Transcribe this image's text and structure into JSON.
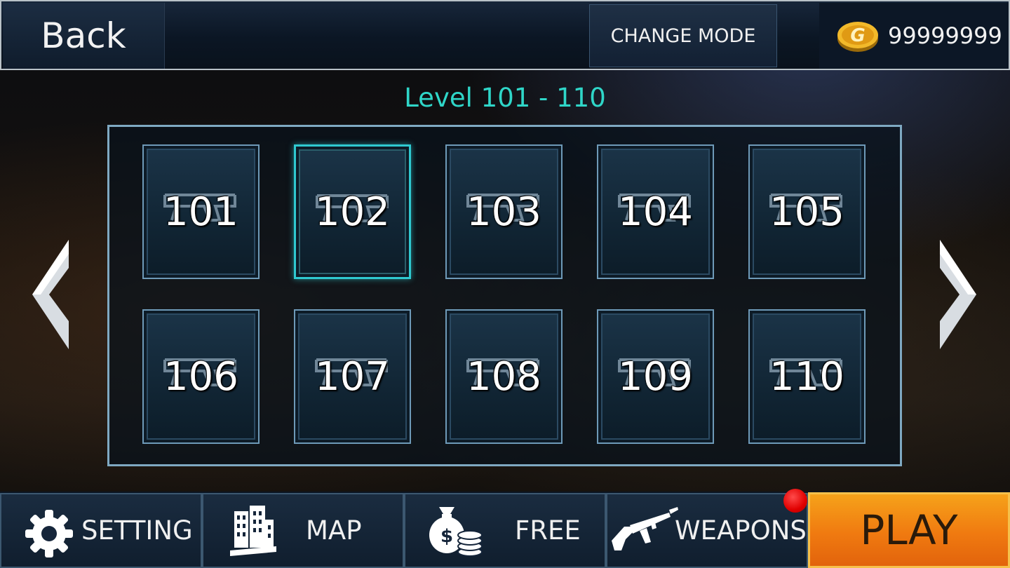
{
  "header": {
    "back_label": "Back",
    "change_mode_label": "CHANGE MODE",
    "coin_icon": "gold-coin-icon",
    "coins": "99999999"
  },
  "level_title": "Level 101 - 110",
  "levels": [
    "101",
    "102",
    "103",
    "104",
    "105",
    "106",
    "107",
    "108",
    "109",
    "110"
  ],
  "selected_level": "102",
  "nav": {
    "left_icon": "chevron-left-icon",
    "right_icon": "chevron-right-icon"
  },
  "bottom": {
    "setting_label": "SETTING",
    "map_label": "MAP",
    "free_label": "FREE",
    "weapons_label": "WEAPONS",
    "play_label": "PLAY"
  },
  "colors": {
    "title": "#2fd6c8",
    "play": "#f07a10",
    "notification": "#e00000"
  }
}
